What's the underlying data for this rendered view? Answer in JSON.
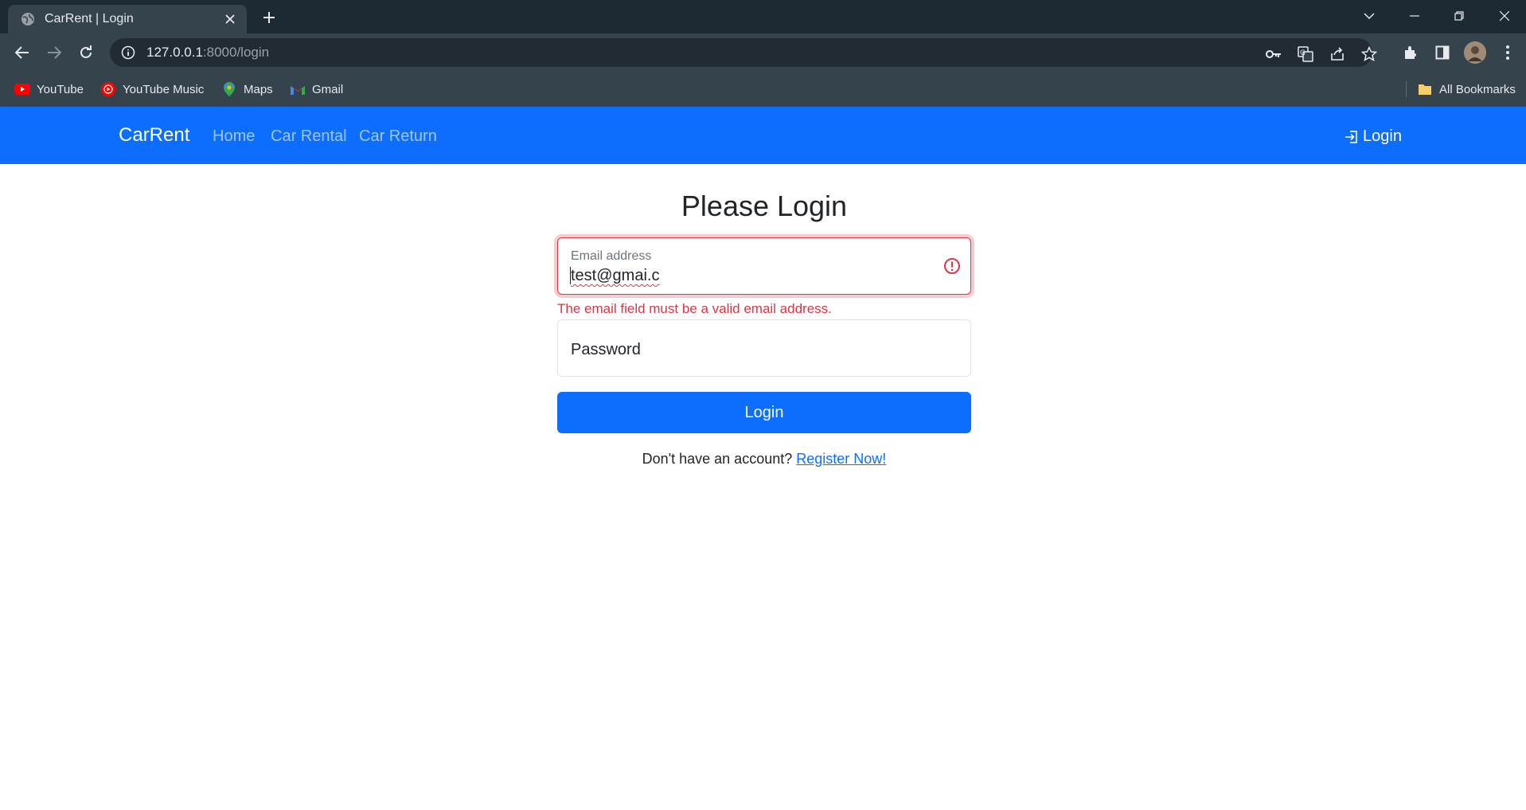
{
  "browser": {
    "tab_title": "CarRent | Login",
    "url_host": "127.0.0.1",
    "url_path": ":8000/login",
    "bookmarks": [
      {
        "label": "YouTube",
        "icon": "youtube-icon"
      },
      {
        "label": "YouTube Music",
        "icon": "youtube-music-icon"
      },
      {
        "label": "Maps",
        "icon": "maps-icon"
      },
      {
        "label": "Gmail",
        "icon": "gmail-icon"
      }
    ],
    "all_bookmarks": "All Bookmarks"
  },
  "navbar": {
    "brand": "CarRent",
    "links": [
      "Home",
      "Car Rental",
      "Car Return"
    ],
    "login": "Login"
  },
  "form": {
    "heading": "Please Login",
    "email_label": "Email address",
    "email_value": "test@gmai.c",
    "email_error": "The email field must be a valid email address.",
    "password_placeholder": "Password",
    "submit": "Login",
    "register_prompt": "Don't have an account?",
    "register_link": "Register Now!"
  },
  "colors": {
    "primary": "#0d6efd",
    "danger": "#dc3545",
    "chrome_dark": "#1e2a33",
    "chrome_toolbar": "#35434c"
  }
}
